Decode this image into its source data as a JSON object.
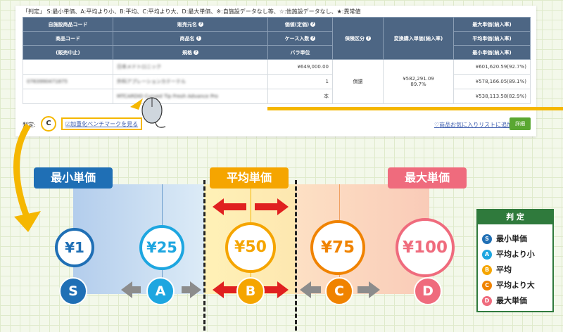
{
  "legend_note": "「判定」 S:最小単価、A:平均より小、B:平均、C:平均より大、D:最大単価、※:自施設データなし等、☆:他施設データなし、★:異常値",
  "table": {
    "h1": [
      "自施設商品コード",
      "販売元名",
      "価値(定価)",
      "保険区分",
      "変換購入単価(納入率)",
      "最大単価(納入率)"
    ],
    "h2": [
      "商品コード",
      "商品名",
      "ケース入数",
      "平均単価(納入率)"
    ],
    "h3": [
      "(販売中止)",
      "規格",
      "バラ単位",
      "最小単価(納入率)"
    ],
    "r1": {
      "vendor": "日本メドトロニック",
      "price": "¥649,000.00",
      "max": "¥601,620.59(92.7%)"
    },
    "r2": {
      "code": "0783990471875",
      "name": "外科アプレーションカテーテル",
      "qty": "1",
      "ins": "償還",
      "unit": "¥582,291.09",
      "rate": "89.7%",
      "avg": "¥578,166.05(89.1%)"
    },
    "r3": {
      "spec": "MTCARDIO Curved Tip Fresh Advance Pro",
      "unit": "本",
      "min": "¥538,113.58(82.9%)"
    }
  },
  "judge_label": "判定:",
  "judge_value": "C",
  "bench_link": "加重化ベンチマークを見る",
  "fav_link": "商品お気に入りリストに追加",
  "detail_btn": "詳細",
  "labels": {
    "min": "最小単価",
    "avg": "平均単価",
    "max": "最大単価"
  },
  "grades": [
    {
      "letter": "S",
      "price": "¥1",
      "color": "#1f6fb5"
    },
    {
      "letter": "A",
      "price": "¥25",
      "color": "#1da6e0"
    },
    {
      "letter": "B",
      "price": "¥50",
      "color": "#f5a500"
    },
    {
      "letter": "C",
      "price": "¥75",
      "color": "#f08300"
    },
    {
      "letter": "D",
      "price": "¥100",
      "color": "#ef6b7d"
    }
  ],
  "legend": {
    "title": "判 定",
    "items": [
      {
        "letter": "S",
        "label": "最小単価",
        "color": "#1f6fb5"
      },
      {
        "letter": "A",
        "label": "平均より小",
        "color": "#1da6e0"
      },
      {
        "letter": "B",
        "label": "平均",
        "color": "#f5a500"
      },
      {
        "letter": "C",
        "label": "平均より大",
        "color": "#f08300"
      },
      {
        "letter": "D",
        "label": "最大単価",
        "color": "#ef6b7d"
      }
    ]
  }
}
